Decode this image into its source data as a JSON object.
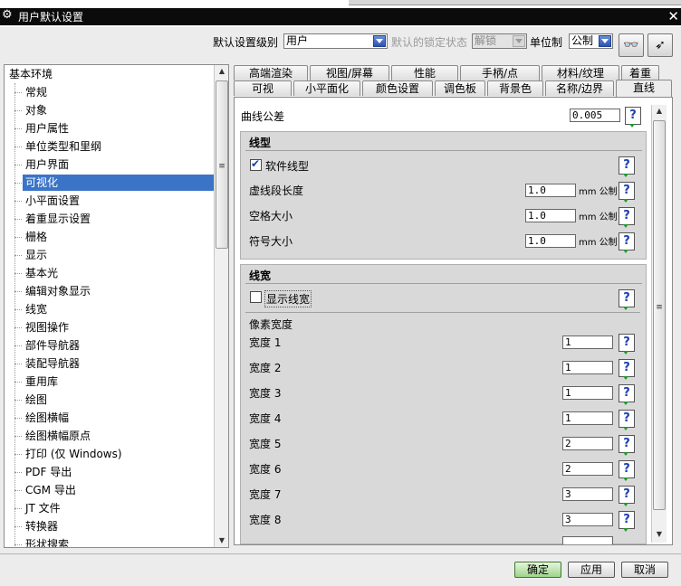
{
  "window": {
    "title": "用户默认设置"
  },
  "toolbar": {
    "level_label": "默认设置级别",
    "level_value": "用户",
    "lock_label": "默认的锁定状态",
    "lock_value": "解锁",
    "unit_label": "单位制",
    "unit_value": "公制"
  },
  "tree": {
    "root": "基本环境",
    "items": [
      "常规",
      "对象",
      "用户属性",
      "单位类型和里纲",
      "用户界面",
      "可视化",
      "小平面设置",
      "着重显示设置",
      "栅格",
      "显示",
      "基本光",
      "编辑对象显示",
      "线宽",
      "视图操作",
      "部件导航器",
      "装配导航器",
      "重用库",
      "绘图",
      "绘图横幅",
      "绘图横幅原点",
      "打印 (仅 Windows)",
      "PDF 导出",
      "CGM 导出",
      "JT 文件",
      "转换器",
      "形状搜索"
    ],
    "selected": "可视化"
  },
  "tabs": {
    "row1": [
      "高端渲染",
      "视图/屏幕",
      "性能",
      "手柄/点",
      "材料/纹理",
      "着重"
    ],
    "row2": [
      "可视",
      "小平面化",
      "颜色设置",
      "调色板",
      "背景色",
      "名称/边界",
      "直线"
    ],
    "active": "直线"
  },
  "panel": {
    "curve_tolerance_label": "曲线公差",
    "curve_tolerance_value": "0.005",
    "linetype": {
      "title": "线型",
      "software_linetype_label": "软件线型",
      "software_linetype_checked": true,
      "rows": [
        {
          "label": "虚线段长度",
          "value": "1.0",
          "unit": "mm 公制"
        },
        {
          "label": "空格大小",
          "value": "1.0",
          "unit": "mm 公制"
        },
        {
          "label": "符号大小",
          "value": "1.0",
          "unit": "mm 公制"
        }
      ]
    },
    "linewidth": {
      "title": "线宽",
      "show_label": "显示线宽",
      "show_checked": false,
      "pixel_width_label": "像素宽度",
      "widths": [
        {
          "label": "宽度 1",
          "value": "1"
        },
        {
          "label": "宽度 2",
          "value": "1"
        },
        {
          "label": "宽度 3",
          "value": "1"
        },
        {
          "label": "宽度 4",
          "value": "1"
        },
        {
          "label": "宽度 5",
          "value": "2"
        },
        {
          "label": "宽度 6",
          "value": "2"
        },
        {
          "label": "宽度 7",
          "value": "3"
        },
        {
          "label": "宽度 8",
          "value": "3"
        }
      ]
    }
  },
  "buttons": {
    "ok": "确定",
    "apply": "应用",
    "cancel": "取消"
  },
  "help_glyph": "?"
}
